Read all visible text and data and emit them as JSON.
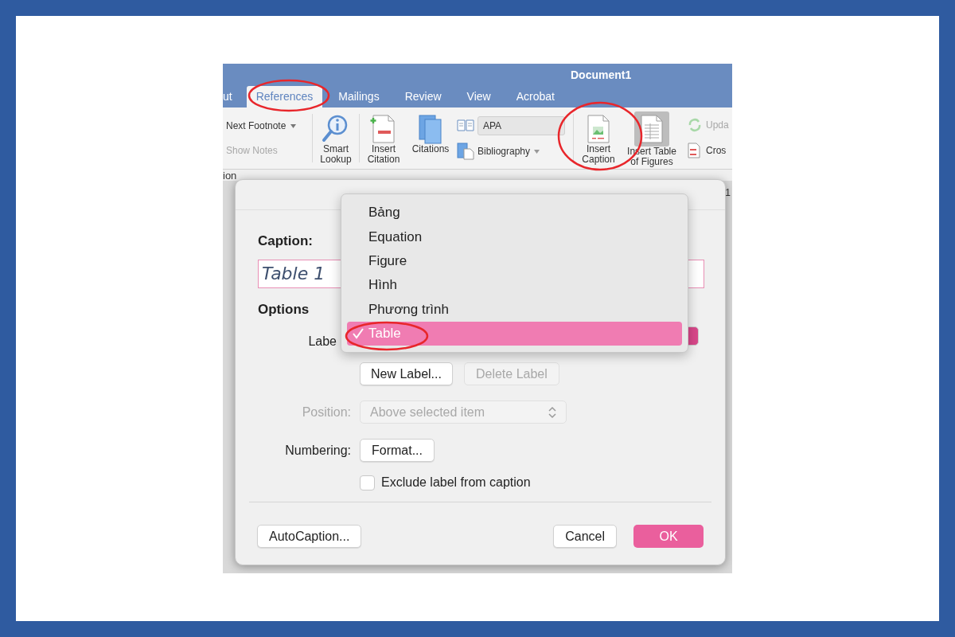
{
  "window": {
    "title": "Document1"
  },
  "tabs": [
    {
      "label": "ut",
      "selected": false
    },
    {
      "label": "References",
      "selected": true
    },
    {
      "label": "Mailings",
      "selected": false
    },
    {
      "label": "Review",
      "selected": false
    },
    {
      "label": "View",
      "selected": false
    },
    {
      "label": "Acrobat",
      "selected": false
    }
  ],
  "ribbon": {
    "next_footnote": "Next Footnote",
    "show_notes": {
      "label": "Show Notes",
      "disabled": true
    },
    "smart_lookup": "Smart Lookup",
    "insert_citation": "Insert Citation",
    "citations": "Citations",
    "style_select": "APA",
    "bibliography": "Bibliography",
    "insert_caption": "Insert Caption",
    "insert_table_of_figures": {
      "label": "Insert Table of Figures",
      "pressed": true
    },
    "update": {
      "label": "Upda",
      "disabled": true
    },
    "cross_reference": "Cros"
  },
  "ruler": {
    "left_text": "ion",
    "right_mark": "1"
  },
  "dialog": {
    "caption_label": "Caption:",
    "caption_value": "Table 1",
    "options_heading": "Options",
    "label_label": "Labe",
    "new_label_button": "New Label...",
    "delete_label_button": {
      "label": "Delete Label",
      "disabled": true
    },
    "position": {
      "label": "Position:",
      "value": "Above selected item",
      "disabled": true
    },
    "numbering_label": "Numbering:",
    "format_button": "Format...",
    "exclude_checkbox": {
      "label": "Exclude label from caption",
      "checked": false
    },
    "autocaption_button": "AutoCaption...",
    "cancel_button": "Cancel",
    "ok_button": "OK"
  },
  "label_menu": {
    "items": [
      {
        "label": "Bảng",
        "selected": false
      },
      {
        "label": "Equation",
        "selected": false
      },
      {
        "label": "Figure",
        "selected": false
      },
      {
        "label": "Hình",
        "selected": false
      },
      {
        "label": "Phương trình",
        "selected": false
      },
      {
        "label": "Table",
        "selected": true
      }
    ]
  }
}
